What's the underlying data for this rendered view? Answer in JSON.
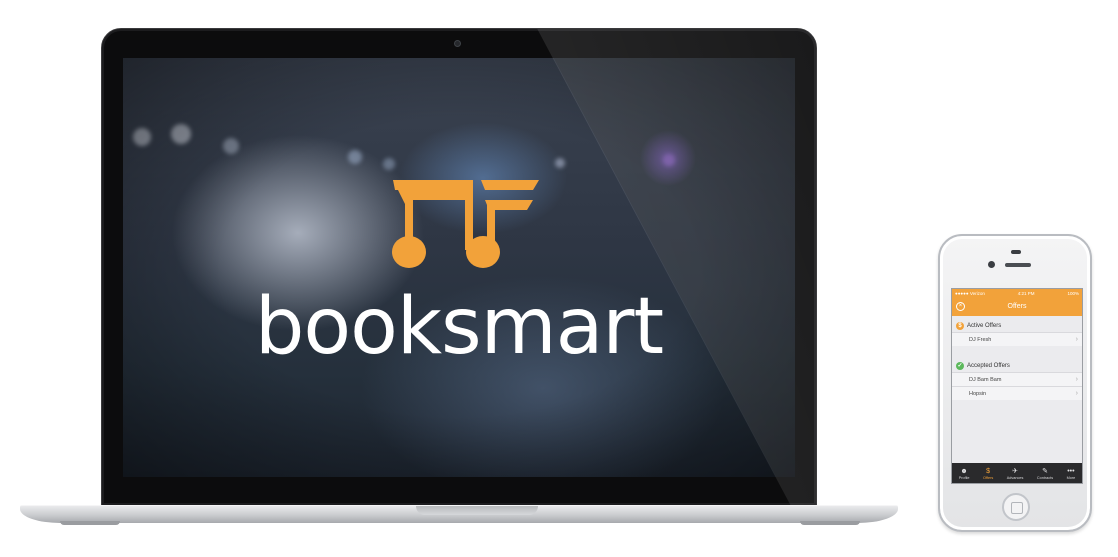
{
  "brand": {
    "name": "booksmart",
    "accent": "#f2a23a"
  },
  "phone": {
    "status": {
      "carrier": "●●●●● Verizon",
      "time": "4:21 PM",
      "battery": "100%"
    },
    "nav_title": "Offers",
    "sections": [
      {
        "title": "Active Offers",
        "icon": "dollar-icon",
        "icon_glyph": "$",
        "icon_color": "#f2a23a",
        "rows": [
          "DJ Fresh"
        ]
      },
      {
        "title": "Accepted Offers",
        "icon": "check-icon",
        "icon_glyph": "✓",
        "icon_color": "#5cb85c",
        "rows": [
          "DJ Bam Bam",
          "Hopsin"
        ]
      }
    ],
    "tabs": [
      {
        "label": "Profile",
        "icon": "person-icon",
        "glyph": "☻"
      },
      {
        "label": "Offers",
        "icon": "dollar-icon",
        "glyph": "$",
        "active": true
      },
      {
        "label": "Advances",
        "icon": "plane-icon",
        "glyph": "✈"
      },
      {
        "label": "Contracts",
        "icon": "pen-icon",
        "glyph": "✎"
      },
      {
        "label": "More",
        "icon": "more-icon",
        "glyph": "•••"
      }
    ]
  }
}
